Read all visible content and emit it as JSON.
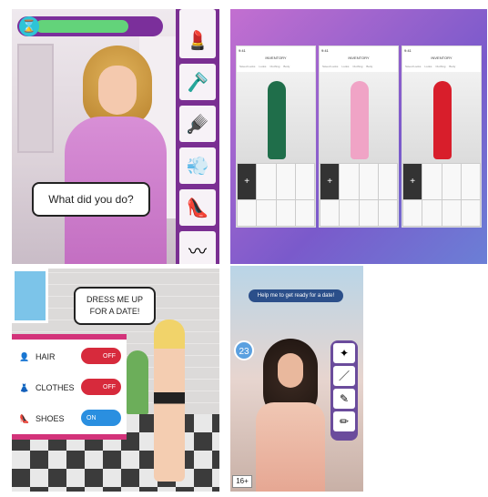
{
  "panel1": {
    "hourglass_icon": "hourglass-icon",
    "timer_progress": 0.75,
    "speech": "What did you do?",
    "tools": [
      "lipstick-icon",
      "razor-icon",
      "hairbrush-icon",
      "hairdryer-icon",
      "heels-icon",
      "comb-icon"
    ]
  },
  "panel2": {
    "screens": [
      {
        "time": "9:41",
        "title": "INVENTORY",
        "tabs": [
          "Saved Looks",
          "Looks",
          "Clothing",
          "Body"
        ],
        "outfit_color": "#1f6e4a"
      },
      {
        "time": "9:41",
        "title": "INVENTORY",
        "tabs": [
          "Saved Looks",
          "Looks",
          "Clothing",
          "Body"
        ],
        "outfit_color": "#f0a4c6"
      },
      {
        "time": "9:41",
        "title": "INVENTORY",
        "tabs": [
          "Saved Looks",
          "Looks",
          "Clothing",
          "Body"
        ],
        "outfit_color": "#d81e2b"
      }
    ],
    "add_label": "+"
  },
  "panel3": {
    "speech_line1": "DRESS ME UP",
    "speech_line2": "FOR A DATE!",
    "rows": [
      {
        "label": "HAIR",
        "state": "OFF"
      },
      {
        "label": "CLOTHES",
        "state": "OFF"
      },
      {
        "label": "SHOES",
        "state": "ON"
      }
    ]
  },
  "panel4": {
    "request": "Help me to get ready for a date!",
    "level": "23",
    "age_rating": "16+"
  }
}
